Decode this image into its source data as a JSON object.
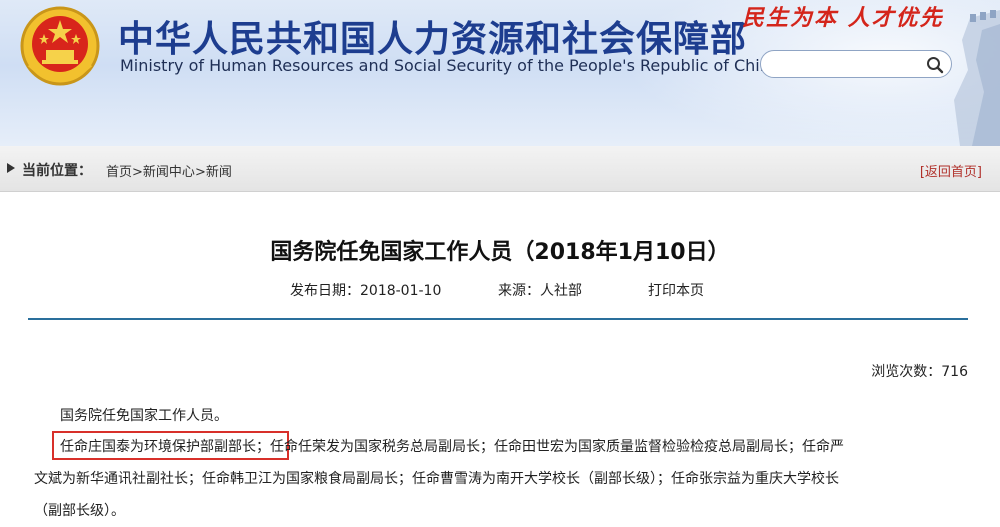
{
  "header": {
    "title_cn": "中华人民共和国人力资源和社会保障部",
    "title_en": "Ministry of Human Resources and Social Security of the People's Republic of China",
    "slogan": "民生为本 人才优先",
    "search_placeholder": ""
  },
  "breadcrumb": {
    "label": "当前位置：",
    "items": [
      "首页",
      ">",
      "新闻中心",
      ">",
      "新闻"
    ],
    "back_home": "[返回首页]"
  },
  "article": {
    "title": "国务院任免国家工作人员（2018年1月10日）",
    "date_label": "发布日期：",
    "date": "2018-01-10",
    "source_label": "来源：",
    "source": "人社部",
    "print": "打印本页",
    "views_label": "浏览次数：",
    "views": "716",
    "intro": "国务院任免国家工作人员。",
    "highlighted": "任命庄国泰为环境保护部副部长",
    "line1_rest": "；任命任荣发为国家税务总局副局长；任命田世宏为国家质量监督检验检疫总局副局长；任命严",
    "line2": "文斌为新华通讯社副社长；任命韩卫江为国家粮食局副局长；任命曹雪涛为南开大学校长（副部长级）；任命张宗益为重庆大学校长",
    "line3": "（副部长级）。"
  },
  "colors": {
    "header_blue": "#1d3d8f",
    "slogan_red": "#d4251b",
    "rule_blue": "#2a6f9c",
    "highlight_red": "#d8302a"
  },
  "icons": {
    "emblem": "national-emblem-icon",
    "search": "search-icon",
    "crumb": "triangle-right-icon"
  }
}
